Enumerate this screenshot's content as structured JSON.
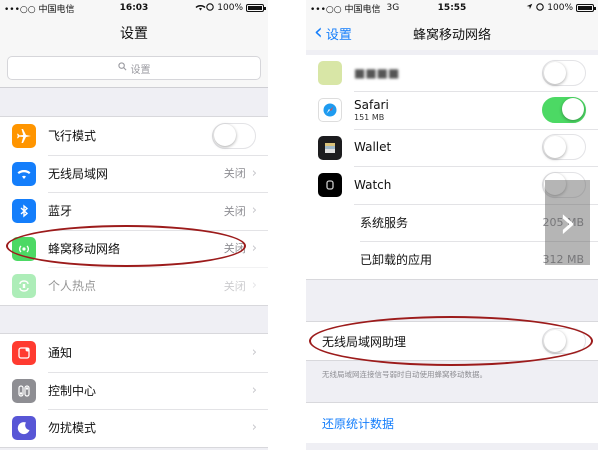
{
  "left": {
    "status": {
      "carrier": "•••○○ 中国电信",
      "wifi": "wifi",
      "time": "16:03",
      "battery": "100%"
    },
    "title": "设置",
    "search_placeholder": "设置",
    "group1": [
      {
        "label": "飞行模式",
        "icon": "airplane-icon",
        "color": "#ff9500",
        "toggle": false
      },
      {
        "label": "无线局域网",
        "icon": "wifi-icon",
        "color": "#147efb",
        "value": "关闭"
      },
      {
        "label": "蓝牙",
        "icon": "bluetooth-icon",
        "color": "#147efb",
        "value": "关闭"
      },
      {
        "label": "蜂窝移动网络",
        "icon": "cellular-icon",
        "color": "#4cd964",
        "value": "关闭",
        "highlighted": true
      },
      {
        "label": "个人热点",
        "icon": "hotspot-icon",
        "color": "#4cd964",
        "value": "关闭",
        "disabled": true
      }
    ],
    "group2": [
      {
        "label": "通知",
        "icon": "notifications-icon",
        "color": "#ff3b30"
      },
      {
        "label": "控制中心",
        "icon": "control-center-icon",
        "color": "#8e8e93"
      },
      {
        "label": "勿扰模式",
        "icon": "moon-icon",
        "color": "#5856d6"
      }
    ]
  },
  "right": {
    "status": {
      "carrier": "•••○○ 中国电信",
      "network": "3G",
      "time": "15:55",
      "battery": "100%"
    },
    "back_label": "设置",
    "title": "蜂窝移动网络",
    "apps": [
      {
        "label": "■■■■",
        "icon": "blurred-app-icon",
        "toggle": false,
        "blurred": true
      },
      {
        "label": "Safari",
        "sub": "151 MB",
        "icon": "safari-icon",
        "toggle": true
      },
      {
        "label": "Wallet",
        "icon": "wallet-icon",
        "toggle": false
      },
      {
        "label": "Watch",
        "icon": "watch-icon",
        "toggle": false
      }
    ],
    "system_rows": [
      {
        "label": "系统服务",
        "value": "205 MB"
      },
      {
        "label": "已卸载的应用",
        "value": "312 MB"
      }
    ],
    "wifi_assist": {
      "label": "无线局域网助理",
      "toggle": false
    },
    "wifi_assist_note": "无线局域网连接信号弱时自动使用蜂窝移动数据。",
    "reset_label": "还原统计数据"
  },
  "arrow": "›"
}
